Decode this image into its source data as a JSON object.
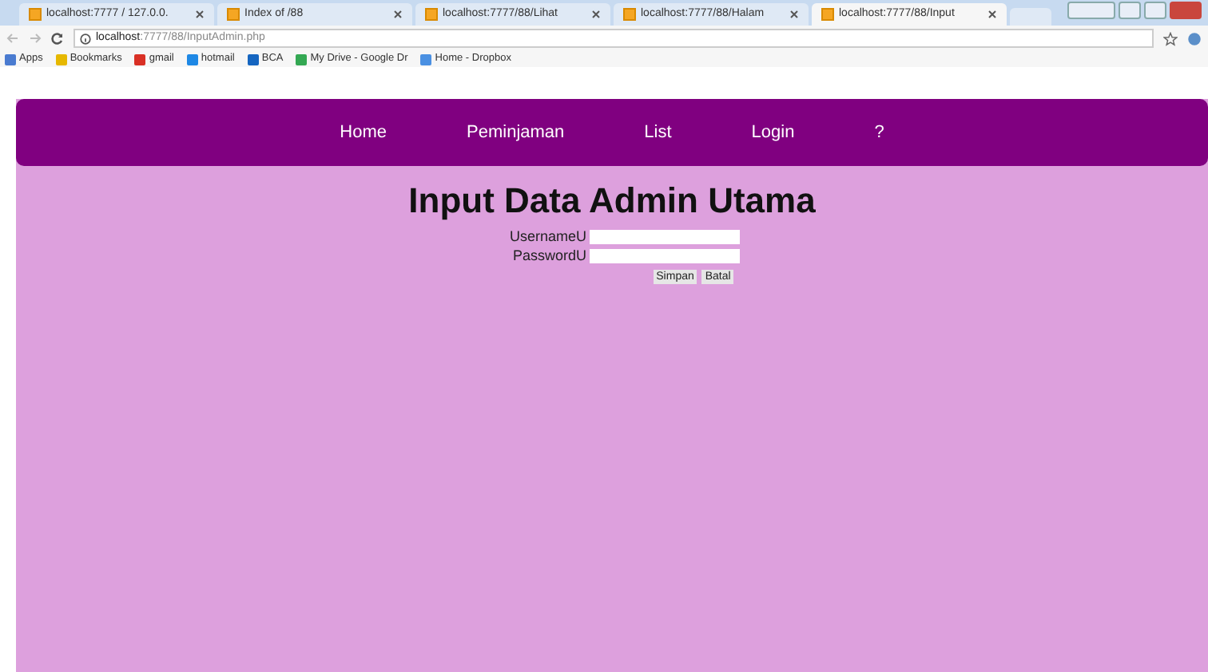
{
  "browser": {
    "tabs": [
      {
        "title": "localhost:7777 / 127.0.0.",
        "selected": false
      },
      {
        "title": "Index of /88",
        "selected": false
      },
      {
        "title": "localhost:7777/88/Lihat",
        "selected": false
      },
      {
        "title": "localhost:7777/88/Halam",
        "selected": false
      },
      {
        "title": "localhost:7777/88/Input",
        "selected": true
      }
    ],
    "address": {
      "host": "localhost",
      "path": ":7777/88/InputAdmin.php"
    },
    "bookmarks": [
      "Apps",
      "Bookmarks",
      "gmail",
      "hotmail",
      "BCA",
      "My Drive - Google Dr",
      "Home - Dropbox"
    ]
  },
  "nav": [
    "Home",
    "Peminjaman",
    "List",
    "Login",
    "?"
  ],
  "heading": "Input Data Admin Utama",
  "form": {
    "fields": [
      {
        "label": "UsernameU"
      },
      {
        "label": "PasswordU"
      }
    ],
    "buttons": [
      "Simpan",
      "Batal"
    ]
  }
}
